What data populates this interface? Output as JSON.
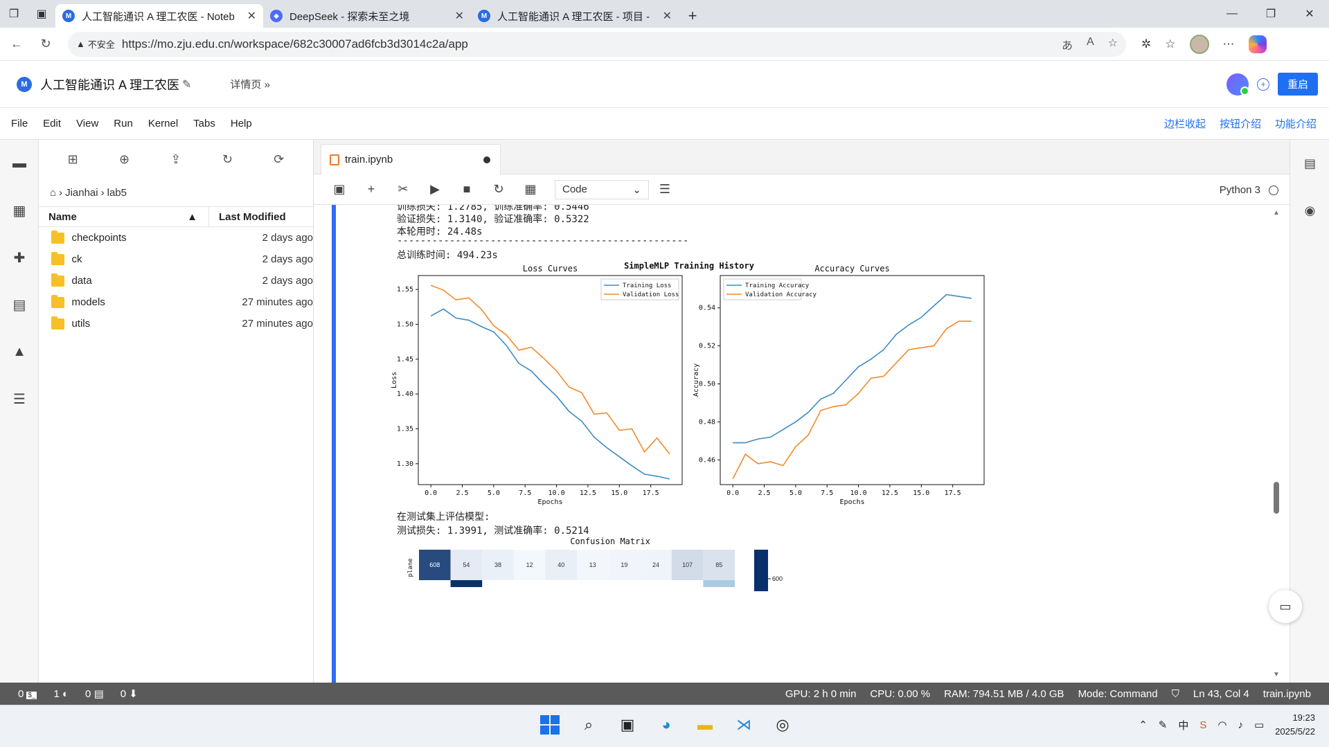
{
  "browser": {
    "tabs": [
      {
        "title": "人工智能通识 A 理工农医 - Noteb",
        "active": true
      },
      {
        "title": "DeepSeek - 探索未至之境",
        "active": false
      },
      {
        "title": "人工智能通识 A 理工农医 - 项目 -",
        "active": false
      }
    ],
    "security_label": "不安全",
    "url": "https://mo.zju.edu.cn/workspace/682c30007ad6fcb3d3014c2a/app"
  },
  "app": {
    "title": "人工智能通识 A 理工农医",
    "details_link": "详情页",
    "restart_label": "重启"
  },
  "menu": {
    "items": [
      "File",
      "Edit",
      "View",
      "Run",
      "Kernel",
      "Tabs",
      "Help"
    ],
    "right_links": [
      "边栏收起",
      "按钮介绍",
      "功能介绍"
    ]
  },
  "filebrowser": {
    "breadcrumb": [
      "Jianhai",
      "lab5"
    ],
    "col_name": "Name",
    "col_modified": "Last Modified",
    "rows": [
      {
        "name": "checkpoints",
        "modified": "2 days ago"
      },
      {
        "name": "ck",
        "modified": "2 days ago"
      },
      {
        "name": "data",
        "modified": "2 days ago"
      },
      {
        "name": "models",
        "modified": "27 minutes ago"
      },
      {
        "name": "utils",
        "modified": "27 minutes ago"
      }
    ]
  },
  "notebook": {
    "tab_title": "train.ipynb",
    "cell_type": "Code",
    "kernel": "Python 3",
    "output": {
      "line0": "训练损失: 1.2785, 训练准确率: 0.5446",
      "line1": "验证损失: 1.3140, 验证准确率: 0.5322",
      "line2": "本轮用时: 24.48s",
      "line3": "--------------------------------------------------",
      "line4": "总训练时间: 494.23s",
      "line5": "在测试集上评估模型:",
      "line6": "测试损失: 1.3991, 测试准确率: 0.5214"
    }
  },
  "chart_data": [
    {
      "type": "line",
      "suptitle": "SimpleMLP Training History",
      "title": "Loss Curves",
      "xlabel": "Epochs",
      "ylabel": "Loss",
      "xlim": [
        -1,
        20
      ],
      "ylim": [
        1.27,
        1.57
      ],
      "xticks": [
        0.0,
        2.5,
        5.0,
        7.5,
        10.0,
        12.5,
        15.0,
        17.5
      ],
      "yticks": [
        1.3,
        1.35,
        1.4,
        1.45,
        1.5,
        1.55
      ],
      "legend_position": "top-right",
      "x": [
        0,
        1,
        2,
        3,
        4,
        5,
        6,
        7,
        8,
        9,
        10,
        11,
        12,
        13,
        14,
        15,
        16,
        17,
        18,
        19
      ],
      "series": [
        {
          "name": "Training Loss",
          "color": "#3b8bc2",
          "values": [
            1.512,
            1.522,
            1.509,
            1.506,
            1.497,
            1.489,
            1.47,
            1.444,
            1.433,
            1.414,
            1.397,
            1.375,
            1.361,
            1.338,
            1.323,
            1.31,
            1.297,
            1.285,
            1.282,
            1.278
          ]
        },
        {
          "name": "Validation Loss",
          "color": "#f28a2a",
          "values": [
            1.556,
            1.549,
            1.535,
            1.538,
            1.522,
            1.498,
            1.485,
            1.463,
            1.467,
            1.451,
            1.433,
            1.41,
            1.402,
            1.371,
            1.373,
            1.348,
            1.35,
            1.317,
            1.337,
            1.314
          ]
        }
      ]
    },
    {
      "type": "line",
      "title": "Accuracy Curves",
      "xlabel": "Epochs",
      "ylabel": "Accuracy",
      "xlim": [
        -1,
        20
      ],
      "ylim": [
        0.447,
        0.557
      ],
      "xticks": [
        0.0,
        2.5,
        5.0,
        7.5,
        10.0,
        12.5,
        15.0,
        17.5
      ],
      "yticks": [
        0.46,
        0.48,
        0.5,
        0.52,
        0.54
      ],
      "legend_position": "top-left",
      "x": [
        0,
        1,
        2,
        3,
        4,
        5,
        6,
        7,
        8,
        9,
        10,
        11,
        12,
        13,
        14,
        15,
        16,
        17,
        18,
        19
      ],
      "series": [
        {
          "name": "Training Accuracy",
          "color": "#3b8bc2",
          "values": [
            0.469,
            0.469,
            0.471,
            0.472,
            0.476,
            0.48,
            0.485,
            0.492,
            0.495,
            0.502,
            0.509,
            0.513,
            0.518,
            0.526,
            0.531,
            0.535,
            0.541,
            0.547,
            0.546,
            0.545
          ]
        },
        {
          "name": "Validation Accuracy",
          "color": "#f28a2a",
          "values": [
            0.45,
            0.463,
            0.458,
            0.459,
            0.457,
            0.467,
            0.473,
            0.486,
            0.488,
            0.489,
            0.495,
            0.503,
            0.504,
            0.511,
            0.518,
            0.519,
            0.52,
            0.529,
            0.533,
            0.533
          ]
        }
      ]
    },
    {
      "type": "heatmap",
      "title": "Confusion Matrix",
      "row_labels": [
        "plane"
      ],
      "values": [
        [
          608,
          54,
          38,
          12,
          40,
          13,
          19,
          24,
          107,
          85
        ]
      ],
      "colorbar_tick": "600"
    }
  ],
  "status": {
    "terminals": "0",
    "kernels": "1",
    "sessions": "0",
    "downloads": "0",
    "gpu": "GPU: 2 h 0 min",
    "cpu": "CPU: 0.00 %",
    "ram": "RAM: 794.51 MB / 4.0 GB",
    "mode": "Mode: Command",
    "cursor": "Ln 43, Col 4",
    "file": "train.ipynb"
  },
  "taskbar": {
    "time": "19:23",
    "date": "2025/5/22",
    "ime": "中"
  }
}
